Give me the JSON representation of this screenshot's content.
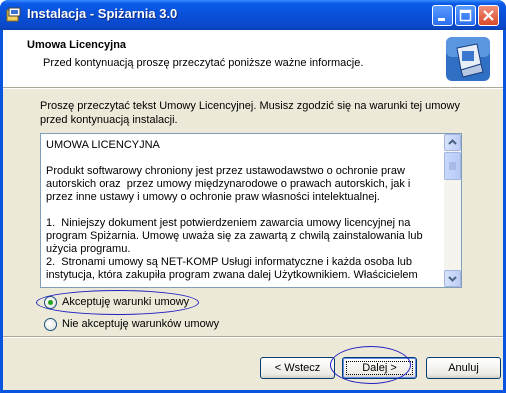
{
  "window": {
    "title": "Instalacja - Spiżarnia 3.0",
    "icons": [
      "installer-app-icon",
      "minimize-icon",
      "maximize-icon",
      "close-icon"
    ]
  },
  "header": {
    "title": "Umowa Licencyjna",
    "subtitle": "Przed kontynuacją proszę przeczytać poniższe ważne informacje.",
    "icon": "setup-computer-icon"
  },
  "main": {
    "intro_text": "Proszę przeczytać tekst Umowy Licencyjnej. Musisz zgodzić się na warunki tej umowy przed kontynuacją instalacji.",
    "license_text": "UMOWA LICENCYJNA\n\nProdukt softwarowy chroniony jest przez ustawodawstwo o ochronie praw autorskich oraz  przez umowy międzynarodowe o prawach autorskich, jak i przez inne ustawy i umowy o ochronie praw własności intelektualnej.\n\n1.  Niniejszy dokument jest potwierdzeniem zawarcia umowy licencyjnej na program Spiżarnia. Umowę uważa się za zawartą z chwilą zainstalowania lub użycia programu.\n2.  Stronami umowy są NET-KOMP Usługi informatyczne i każda osoba lub instytucja, która zakupiła program zwana dalej Użytkownikiem. Właścicielem",
    "accept_label": "Akceptuję warunki umowy",
    "decline_label": "Nie akceptuję warunków umowy",
    "accept_selected": true
  },
  "buttons": {
    "back_label": "< Wstecz",
    "next_label": "Dalej >",
    "cancel_label": "Anuluj"
  },
  "colors": {
    "titlebar": "#0a55e0",
    "annotation_ellipse": "#2020c0",
    "radio_selected": "#21a121"
  }
}
